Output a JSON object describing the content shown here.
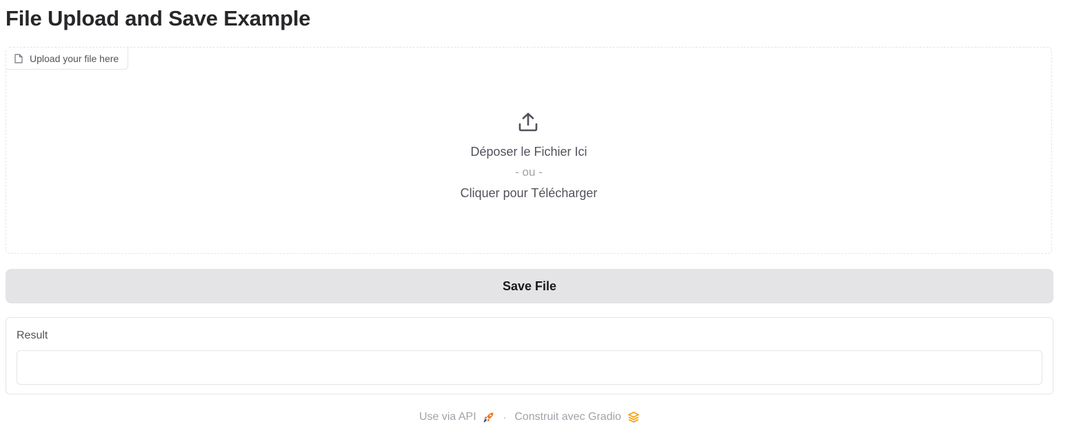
{
  "page": {
    "title": "File Upload and Save Example"
  },
  "upload": {
    "label": "Upload your file here",
    "drop_text": "Déposer le Fichier Ici",
    "or_text": "- ou -",
    "click_text": "Cliquer pour Télécharger",
    "icons": {
      "label_icon": "file-icon",
      "upload_icon": "upload-icon"
    }
  },
  "actions": {
    "save_label": "Save File"
  },
  "result": {
    "label": "Result",
    "value": ""
  },
  "footer": {
    "api_label": "Use via API",
    "separator": "·",
    "built_label": "Construit avec Gradio",
    "icons": {
      "api_icon": "rocket-icon",
      "gradio_icon": "gradio-logo-icon"
    }
  },
  "colors": {
    "button_bg": "#e4e4e7",
    "border": "#e4e4e7",
    "muted_text": "#a1a1aa",
    "accent_orange": "#f97316"
  }
}
